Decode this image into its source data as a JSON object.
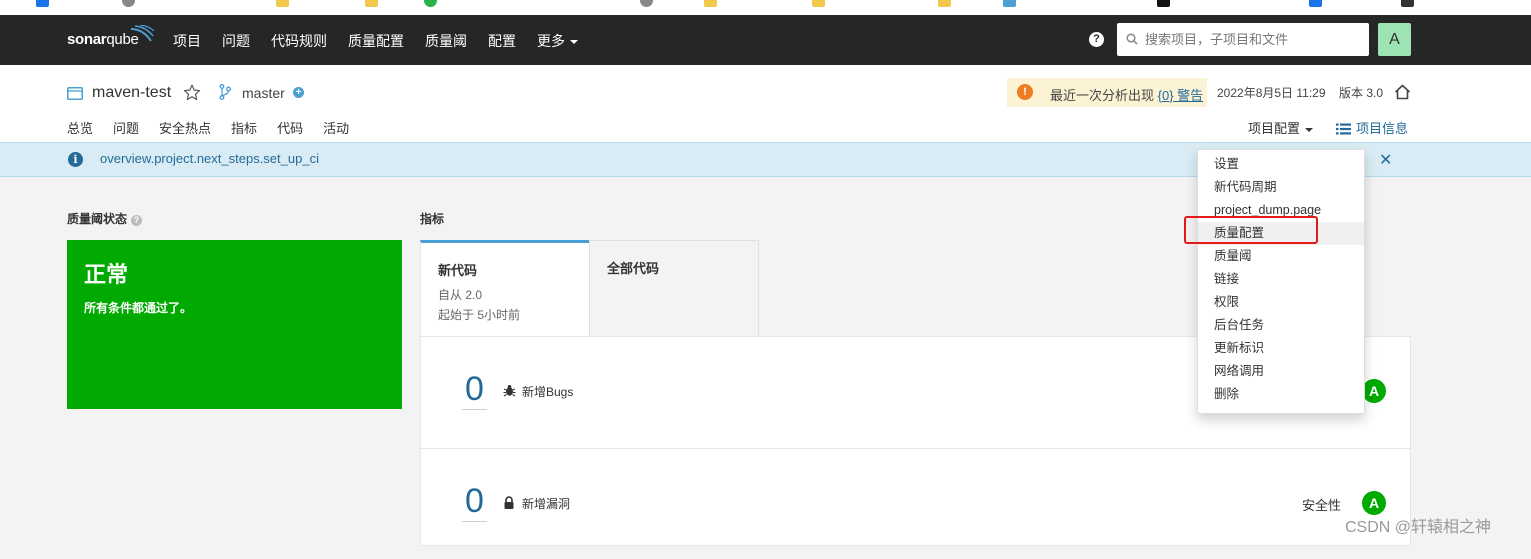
{
  "app": {
    "logo_text_bold": "sonar",
    "logo_text_thin": "qube"
  },
  "nav": {
    "items": [
      "项目",
      "问题",
      "代码规则",
      "质量配置",
      "质量阈",
      "配置"
    ],
    "more": "更多",
    "search_placeholder": "搜索项目，子项目和文件",
    "avatar": "A"
  },
  "project": {
    "name": "maven-test",
    "branch": "master",
    "warning_prefix": "最近一次分析出现 ",
    "warning_link": "{0} 警告",
    "analysis_date": "2022年8月5日 11:29",
    "version": "版本 3.0",
    "tabs": [
      "总览",
      "问题",
      "安全热点",
      "指标",
      "代码",
      "活动"
    ],
    "config_menu": "项目配置",
    "project_info": "项目信息"
  },
  "banner": {
    "text": "overview.project.next_steps.set_up_ci"
  },
  "quality_gate": {
    "title": "质量阈状态",
    "status": "正常",
    "message": "所有条件都通过了。",
    "color": "#00aa00"
  },
  "metrics": {
    "title": "指标",
    "tab_new": "新代码",
    "tab_new_since": "自从 2.0",
    "tab_new_started": "起始于 5小时前",
    "tab_all": "全部代码",
    "rows": [
      {
        "value": "0",
        "label": "新增Bugs",
        "rating_label": "",
        "rating": "A",
        "icon": "bug-icon"
      },
      {
        "value": "0",
        "label": "新增漏洞",
        "rating_label": "安全性",
        "rating": "A",
        "icon": "lock-icon"
      }
    ]
  },
  "dropdown": {
    "items": [
      "设置",
      "新代码周期",
      "project_dump.page",
      "质量配置",
      "质量阈",
      "链接",
      "权限",
      "后台任务",
      "更新标识",
      "网络调用",
      "删除"
    ],
    "highlighted": "质量配置"
  },
  "watermark": "CSDN @轩辕相之神"
}
